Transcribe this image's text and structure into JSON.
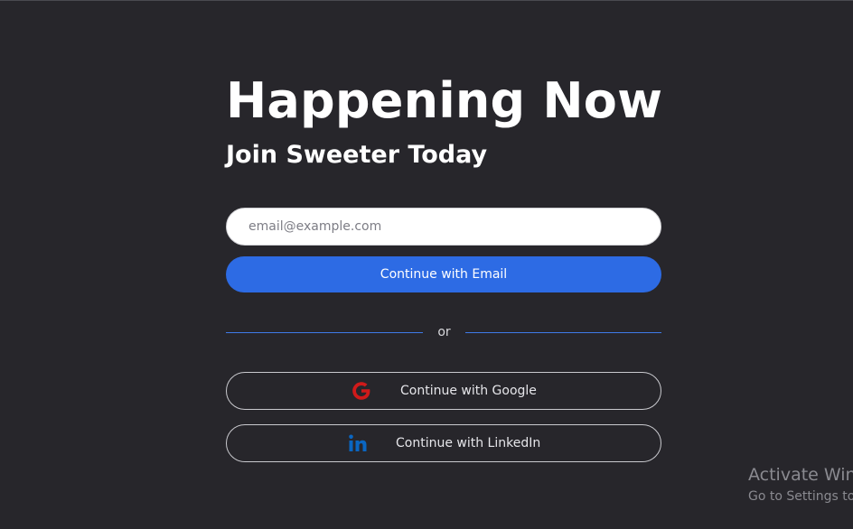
{
  "hero": {
    "title": "Happening Now",
    "subtitle": "Join Sweeter Today"
  },
  "form": {
    "email_placeholder": "email@example.com",
    "email_value": "",
    "continue_email_label": "Continue with Email",
    "divider_text": "or",
    "google_label": "Continue with Google",
    "linkedin_label": "Continue with LinkedIn"
  },
  "icons": {
    "google": "google-g-icon",
    "linkedin": "linkedin-in-icon"
  },
  "colors": {
    "background": "#27262b",
    "primary_button": "#2d6be4",
    "divider_line": "#3f7be8",
    "google_icon": "#d01a1a",
    "linkedin_icon": "#0a66c2"
  },
  "watermark": {
    "title": "Activate Windows",
    "subtitle": "Go to Settings to activate Windows."
  }
}
